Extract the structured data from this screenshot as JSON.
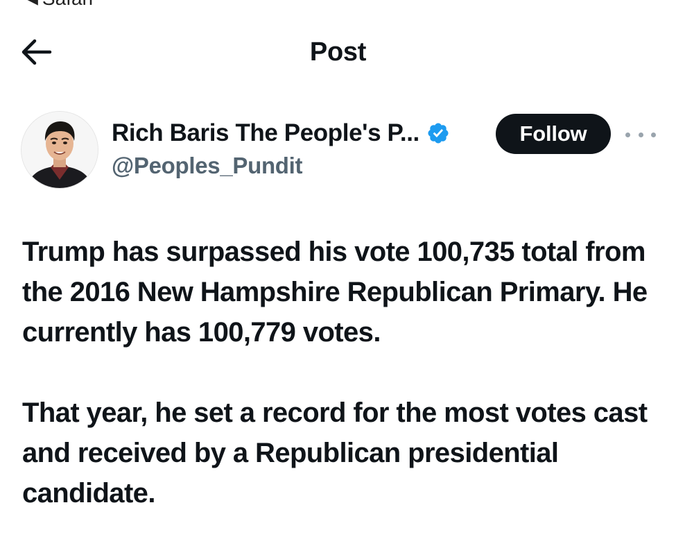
{
  "status_bar": {
    "back_app_label": "Safari"
  },
  "nav": {
    "title": "Post"
  },
  "author": {
    "display_name": "Rich Baris The People's P...",
    "handle": "@Peoples_Pundit",
    "verified": true,
    "follow_label": "Follow"
  },
  "post": {
    "paragraphs": [
      "Trump has surpassed his vote 100,735 total from the 2016 New Hampshire Republican Primary. He currently has 100,779 votes.",
      "That year, he set a record for the most votes cast and received by a Republican presidential candidate."
    ]
  },
  "colors": {
    "text": "#0f1419",
    "secondary_text": "#536471",
    "verified_blue": "#1d9bf0",
    "follow_button_bg": "#0f1419",
    "follow_button_text": "#ffffff"
  },
  "icons": {
    "back": "arrow-left-icon",
    "verified": "verified-badge-icon",
    "more": "more-horizontal-icon"
  }
}
